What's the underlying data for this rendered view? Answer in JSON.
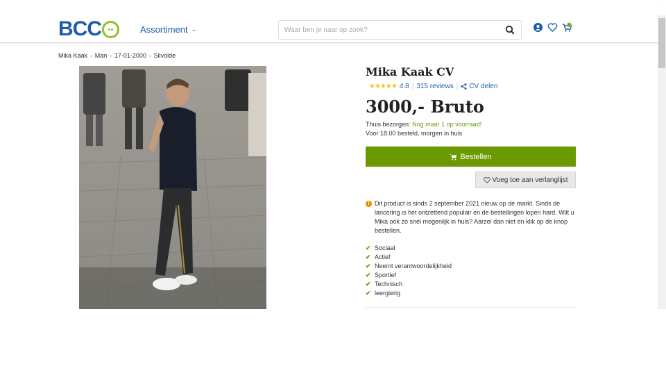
{
  "header": {
    "logo_text": "BCC",
    "nav_label": "Assortiment",
    "search_placeholder": "Waar ben je naar op zoek?",
    "cart_count": "0",
    "icons": [
      "account-icon",
      "heart-icon",
      "cart-icon"
    ],
    "brand_color": "#1f5ba8",
    "accent_color": "#8fc31f"
  },
  "breadcrumb": [
    "Mika Kaak",
    "Man",
    "17-01-2000",
    "Silvolde"
  ],
  "product": {
    "title": "Mika Kaak CV",
    "stars": "★★★★★",
    "rating": "4.8",
    "reviews": "315 reviews",
    "share_label": "CV delen",
    "price": "3000,- Bruto",
    "delivery_prefix": "Thuis bezorgen:",
    "delivery_stock": "Nog maar 1 op voorraad!",
    "delivery_note": "Voor 18.00 besteld, morgen in huis",
    "order_button": "Bestellen",
    "wishlist_button": "Voeg toe aan verlanglijst",
    "info_text": "Dit product is sinds 2 september 2021 nieuw op de markt. Sinds de lancering is het ontzettend populair en de bestellingen lopen hard. Wilt u Mika ook zo snel mogenlijk in huis? Aarzel dan niet en klik op de knop bestellen.",
    "features": [
      "Sociaal",
      "Actief",
      "Neemt verantwoordelijkheid",
      "Sportief",
      "Technisch",
      "leergierig"
    ],
    "order_color": "#6b9900"
  }
}
